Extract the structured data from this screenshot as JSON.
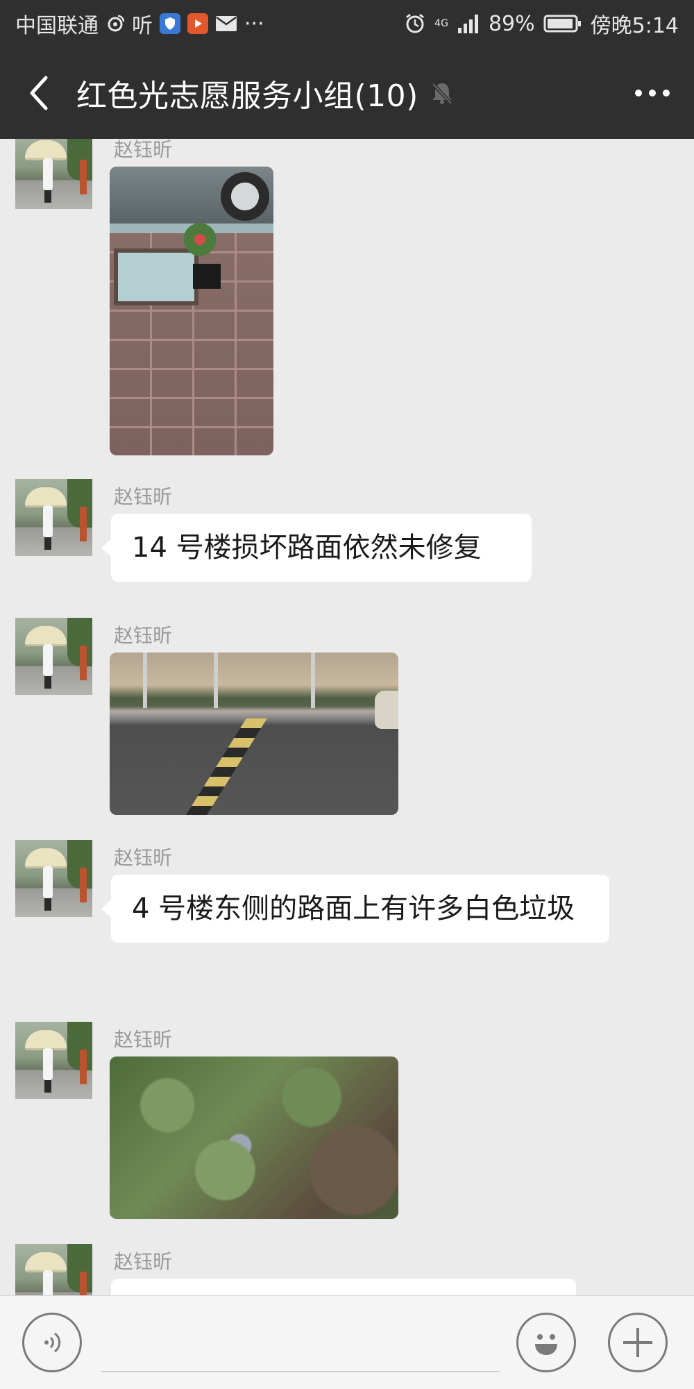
{
  "status_bar": {
    "carrier": "中国联通",
    "listen_text": "听",
    "network": "4G",
    "battery": "89%",
    "time": "傍晚5:14",
    "overflow": "···"
  },
  "header": {
    "title": "红色光志愿服务小组(10)"
  },
  "messages": [
    {
      "sender": "赵钰昕",
      "type": "image"
    },
    {
      "sender": "赵钰昕",
      "type": "text",
      "text": "14 号楼损坏路面依然未修复"
    },
    {
      "sender": "赵钰昕",
      "type": "image"
    },
    {
      "sender": "赵钰昕",
      "type": "text",
      "text": "4 号楼东侧的路面上有许多白色垃圾"
    },
    {
      "sender": "赵钰昕",
      "type": "image"
    },
    {
      "sender": "赵钰昕",
      "type": "text",
      "text": ""
    }
  ],
  "colors": {
    "header_bg": "#2f2f2f",
    "chat_bg": "#ebebeb",
    "bubble_bg": "#ffffff",
    "sender_text": "#999999"
  },
  "icons": {
    "back": "chevron-left-icon",
    "mute": "bell-off-icon",
    "more": "more-dots-icon",
    "voice": "voice-icon",
    "emoji": "emoji-icon",
    "plus": "plus-icon"
  }
}
